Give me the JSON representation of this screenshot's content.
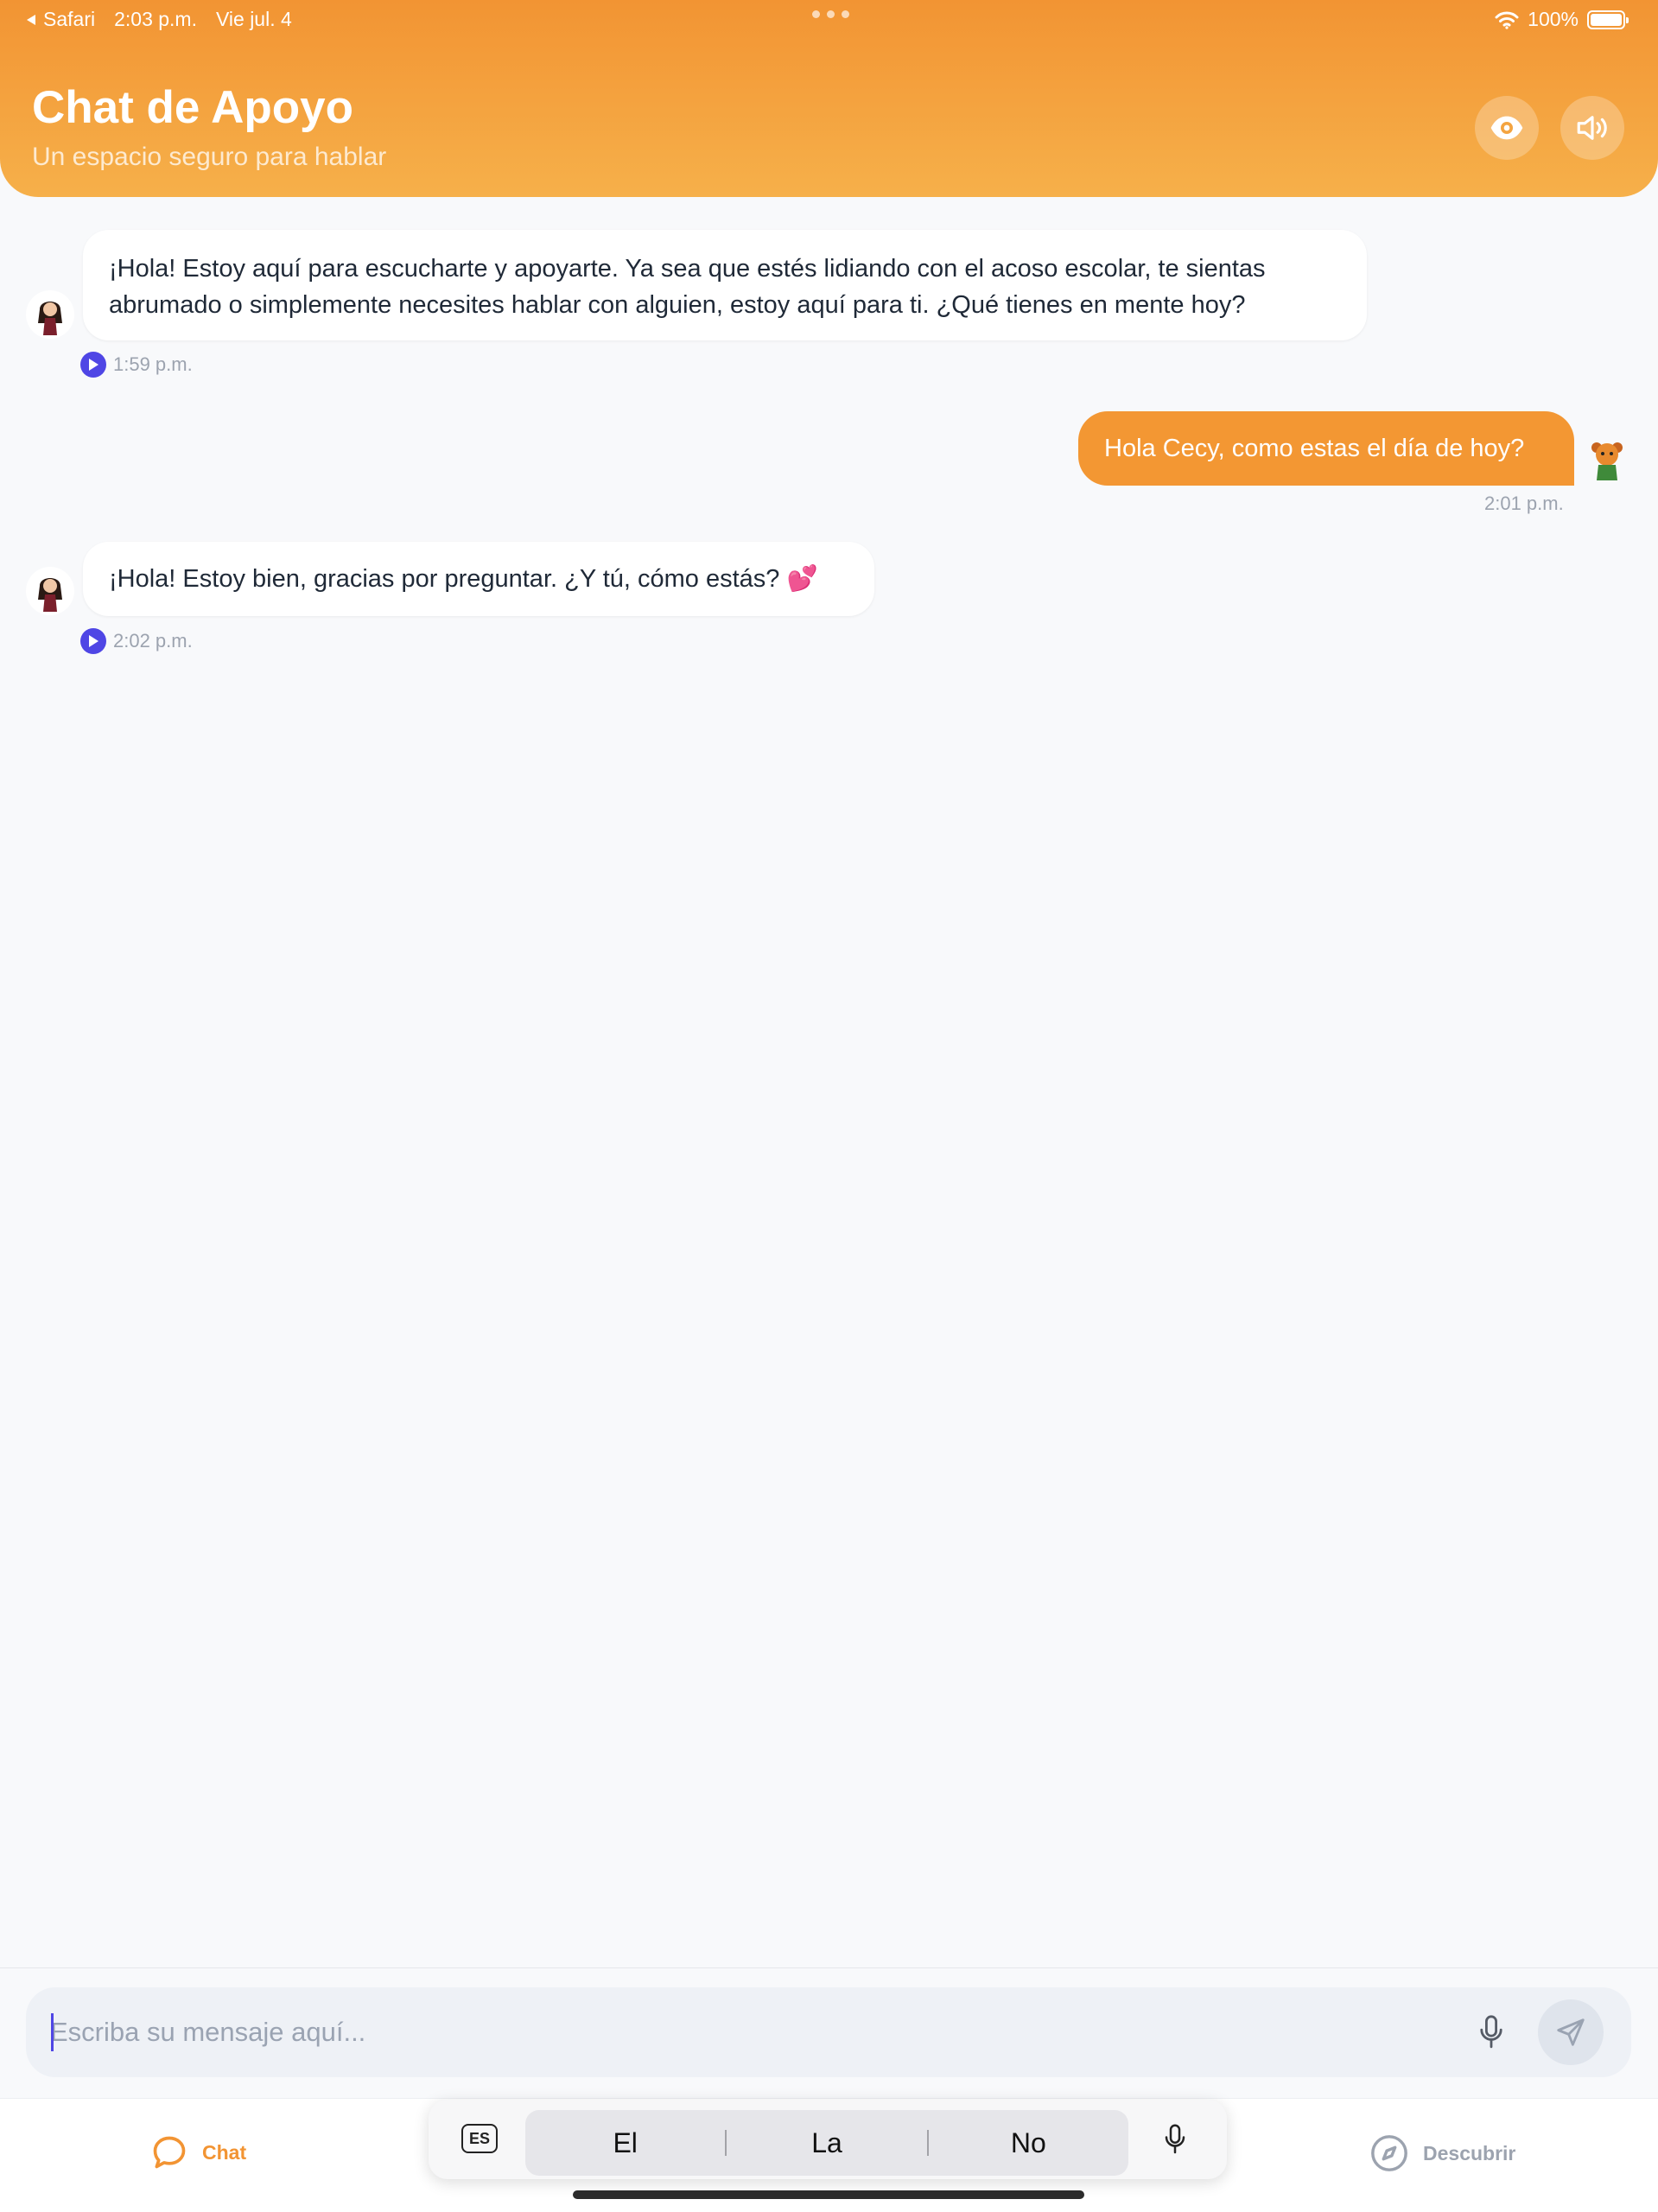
{
  "status_bar": {
    "back_app": "Safari",
    "time": "2:03 p.m.",
    "date": "Vie jul. 4",
    "battery": "100%"
  },
  "header": {
    "title": "Chat de Apoyo",
    "subtitle": "Un espacio seguro para hablar",
    "buttons": [
      "eye-icon",
      "speaker-icon"
    ]
  },
  "messages": [
    {
      "sender": "bot",
      "lines": [
        "¡Hola! Estoy aquí para escucharte y apoyarte. Ya sea que estés lidiando con el acoso escolar, te sientas",
        "abrumado o simplemente necesites hablar con alguien, estoy aquí para ti. ¿Qué tienes en mente hoy?"
      ],
      "time": "1:59 p.m."
    },
    {
      "sender": "user",
      "text": "Hola Cecy, como estas el día de hoy?",
      "time": "2:01 p.m."
    },
    {
      "sender": "bot",
      "text": "¡Hola! Estoy bien, gracias por preguntar. ¿Y tú, cómo estás? 💕",
      "time": "2:02 p.m."
    }
  ],
  "composer": {
    "placeholder": "Escriba su mensaje aquí..."
  },
  "tabs": {
    "chat": "Chat",
    "discover": "Descubrir"
  },
  "keyboard": {
    "lang": "ES",
    "suggestions": [
      "El",
      "La",
      "No"
    ]
  },
  "colors": {
    "accent": "#f29433",
    "play": "#4f46e5",
    "background": "#f8f9fb"
  }
}
